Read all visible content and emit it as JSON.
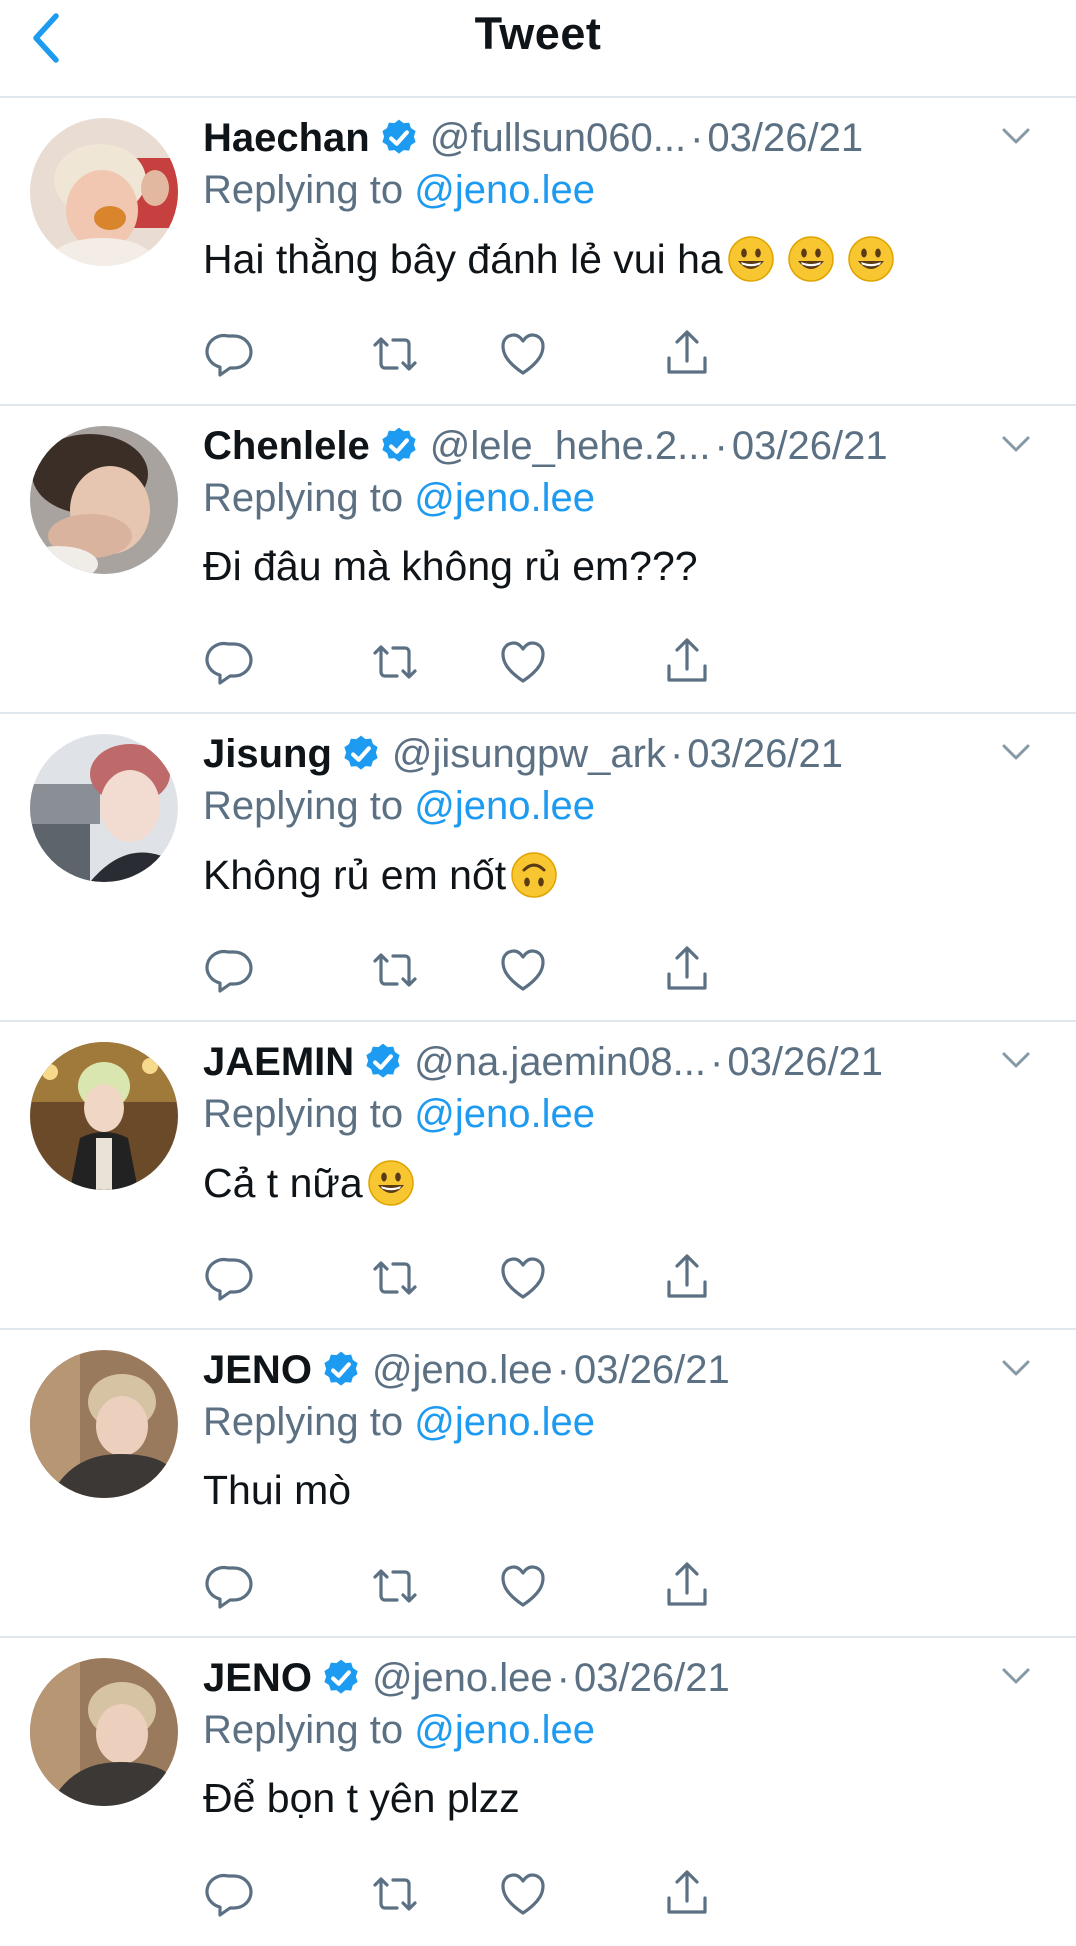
{
  "header": {
    "title": "Tweet"
  },
  "colors": {
    "link_blue": "#1d9bf0",
    "secondary_text": "#5b7083",
    "divider": "#e1e8ed",
    "verified_badge": "#1d9bf0"
  },
  "icons": {
    "back": "chevron-left-icon",
    "verified": "verified-badge-icon",
    "more": "chevron-down-icon",
    "reply": "comment-icon",
    "retweet": "retweet-icon",
    "like": "heart-icon",
    "share": "share-icon"
  },
  "tweets": [
    {
      "name": "Haechan",
      "handle": "@fullsun060...",
      "dot": "·",
      "date": "03/26/21",
      "replying_prefix": "Replying to",
      "replying_to": "@jeno.lee",
      "text": "Hai thằng bây đánh lẻ vui ha",
      "emojis": [
        "grinning-face-emoji",
        "grinning-face-emoji",
        "grinning-face-emoji"
      ]
    },
    {
      "name": "Chenlele",
      "handle": "@lele_hehe.2...",
      "dot": "·",
      "date": "03/26/21",
      "replying_prefix": "Replying to",
      "replying_to": "@jeno.lee",
      "text": "Đi đâu mà không rủ em???",
      "emojis": []
    },
    {
      "name": "Jisung",
      "handle": "@jisungpw_ark",
      "dot": "·",
      "date": "03/26/21",
      "replying_prefix": "Replying to",
      "replying_to": "@jeno.lee",
      "text": "Không rủ em nốt",
      "emojis": [
        "upside-down-face-emoji"
      ]
    },
    {
      "name": "JAEMIN",
      "handle": "@na.jaemin08...",
      "dot": "·",
      "date": "03/26/21",
      "replying_prefix": "Replying to",
      "replying_to": "@jeno.lee",
      "text": "Cả t nữa",
      "emojis": [
        "grinning-face-emoji"
      ]
    },
    {
      "name": "JENO",
      "handle": "@jeno.lee",
      "dot": "·",
      "date": "03/26/21",
      "replying_prefix": "Replying to",
      "replying_to": "@jeno.lee",
      "text": "Thui mò",
      "emojis": []
    },
    {
      "name": "JENO",
      "handle": "@jeno.lee",
      "dot": "·",
      "date": "03/26/21",
      "replying_prefix": "Replying to",
      "replying_to": "@jeno.lee",
      "text": "Để bọn t yên plzz",
      "emojis": []
    }
  ]
}
